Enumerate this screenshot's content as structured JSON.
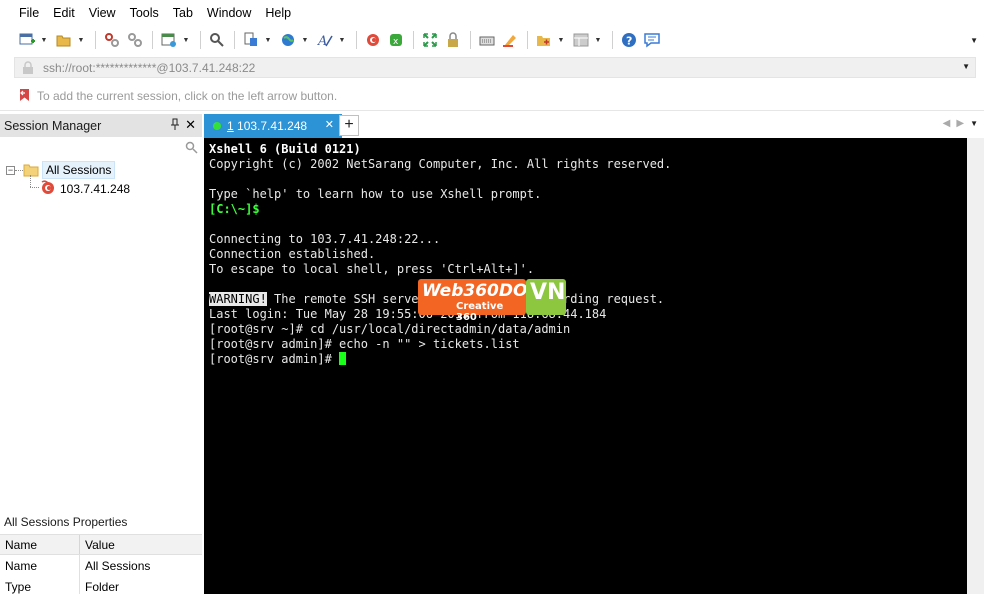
{
  "menu": [
    "File",
    "Edit",
    "View",
    "Tools",
    "Tab",
    "Window",
    "Help"
  ],
  "toolbar": {
    "icons": [
      "new-session-icon",
      "open-folder-icon",
      "disconnect-icon",
      "reconnect-icon",
      "new-window-icon",
      "find-icon",
      "transfer-icon",
      "globe-icon",
      "font-icon",
      "xftp-icon",
      "xmanager-icon",
      "fullscreen-icon",
      "lock-icon",
      "keyboard-icon",
      "highlight-icon",
      "add-script-icon",
      "layout-icon",
      "help-icon",
      "chat-icon"
    ]
  },
  "address": {
    "value": "ssh://root:*************@103.7.41.248:22"
  },
  "hint": {
    "text": "To add the current session, click on the left arrow button."
  },
  "session_manager": {
    "title": "Session Manager",
    "pin_label": "I",
    "close_label": "✕",
    "tree": {
      "root_label": "All Sessions",
      "toggle": "−",
      "children": [
        "103.7.41.248"
      ]
    }
  },
  "properties": {
    "title": "All Sessions Properties",
    "columns": [
      "Name",
      "Value"
    ],
    "rows": [
      [
        "Name",
        "All Sessions"
      ],
      [
        "Type",
        "Folder"
      ]
    ]
  },
  "tabs": [
    {
      "number": "1",
      "label": "103.7.41.248",
      "active": true
    }
  ],
  "tab_add": "+",
  "terminal": {
    "lines": [
      {
        "text": "Xshell 6 (Build 0121)",
        "style": "bold"
      },
      {
        "text": "Copyright (c) 2002 NetSarang Computer, Inc. All rights reserved.",
        "style": "normal"
      },
      {
        "text": "",
        "style": "normal"
      },
      {
        "text": "Type `help' to learn how to use Xshell prompt.",
        "style": "normal"
      },
      {
        "text": "[C:\\~]$",
        "style": "prompt"
      },
      {
        "text": "",
        "style": "normal"
      },
      {
        "text": "Connecting to 103.7.41.248:22...",
        "style": "normal"
      },
      {
        "text": "Connection established.",
        "style": "normal"
      },
      {
        "text": "To escape to local shell, press 'Ctrl+Alt+]'.",
        "style": "normal"
      },
      {
        "text": "",
        "style": "normal"
      },
      {
        "text": "WARNING!",
        "rest": " The remote SSH server rejected X11 forwarding request.",
        "style": "warning"
      },
      {
        "text": "Last login: Tue May 28 19:55:06 2019 from 118.68.44.184",
        "style": "normal"
      },
      {
        "text": "[root@srv ~]# cd /usr/local/directadmin/data/admin",
        "style": "normal"
      },
      {
        "text": "[root@srv admin]# echo -n \"\" > tickets.list",
        "style": "normal"
      },
      {
        "text": "[root@srv admin]# ",
        "style": "cursor"
      }
    ]
  },
  "watermark": {
    "brand": "Web360DO",
    "sub": "Creative 360",
    "vn": "VN"
  },
  "colors": {
    "tab_active": "#2b93d6",
    "terminal_bg": "#000000",
    "prompt_green": "#3cff3c",
    "cursor_green": "#19ff19"
  }
}
